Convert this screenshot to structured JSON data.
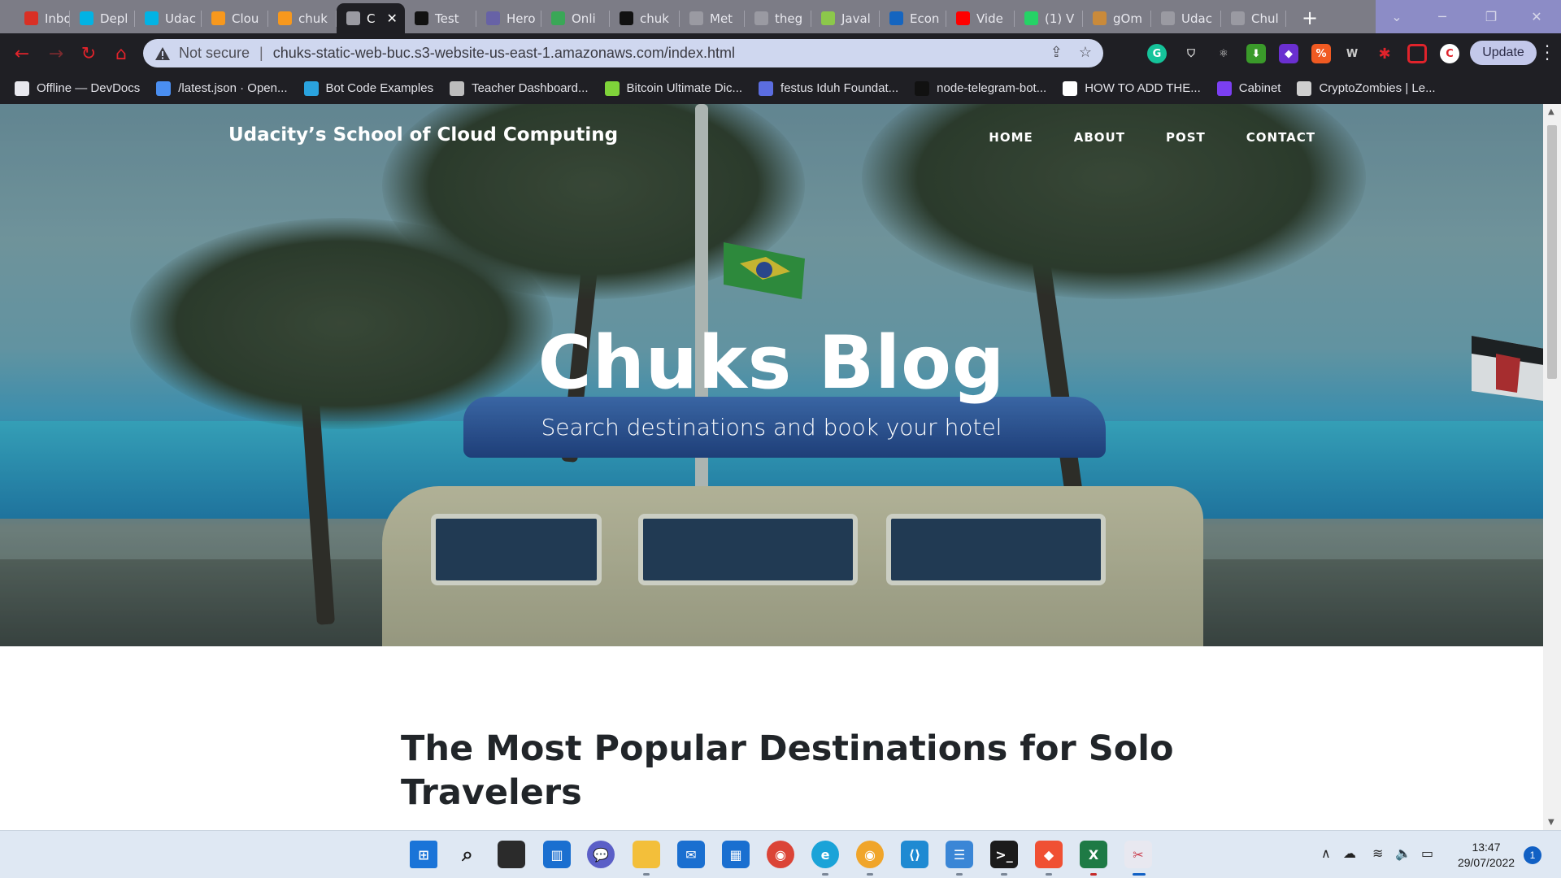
{
  "browser": {
    "tabs": [
      {
        "label": "Inbox",
        "icon": "gmail-icon",
        "color": "#d93025"
      },
      {
        "label": "Depl",
        "icon": "udacity-icon",
        "color": "#02b3e4"
      },
      {
        "label": "Udac",
        "icon": "udacity-icon",
        "color": "#02b3e4"
      },
      {
        "label": "Clou",
        "icon": "aws-icon",
        "color": "#f7981d"
      },
      {
        "label": "chuk",
        "icon": "aws-icon",
        "color": "#f7981d"
      },
      {
        "label": "C",
        "icon": "globe-icon",
        "color": "#9a9aa2",
        "active": true
      },
      {
        "label": "Test",
        "icon": "codementor-icon",
        "color": "#111111"
      },
      {
        "label": "Hero",
        "icon": "heroku-icon",
        "color": "#6762a6"
      },
      {
        "label": "Onli",
        "icon": "online-tool-icon",
        "color": "#3aa757"
      },
      {
        "label": "chuk",
        "icon": "github-icon",
        "color": "#111111"
      },
      {
        "label": "Met",
        "icon": "globe-icon",
        "color": "#9a9aa2"
      },
      {
        "label": "theg",
        "icon": "globe-icon",
        "color": "#9a9aa2"
      },
      {
        "label": "Javal",
        "icon": "javascript-icon",
        "color": "#8cc84b"
      },
      {
        "label": "Econ",
        "icon": "econ-icon",
        "color": "#1565c0"
      },
      {
        "label": "Vide",
        "icon": "youtube-icon",
        "color": "#ff0000"
      },
      {
        "label": "(1) V",
        "icon": "whatsapp-icon",
        "color": "#25d366"
      },
      {
        "label": "gOm",
        "icon": "avatar-icon",
        "color": "#c98a3a"
      },
      {
        "label": "Udac",
        "icon": "globe-icon",
        "color": "#9a9aa2"
      },
      {
        "label": "Chul",
        "icon": "globe-icon",
        "color": "#9a9aa2"
      }
    ],
    "address": {
      "security_label": "Not secure",
      "separator": "|",
      "url": "chuks-static-web-buc.s3-website-us-east-1.amazonaws.com/index.html"
    },
    "update_label": "Update",
    "bookmarks": [
      {
        "label": "Offline — DevDocs",
        "icon": "devdocs-icon",
        "color": "#e8e8ee"
      },
      {
        "label": "/latest.json · Open...",
        "icon": "book-icon",
        "color": "#4a8ef0"
      },
      {
        "label": "Bot Code Examples",
        "icon": "telegram-icon",
        "color": "#2aa3de"
      },
      {
        "label": "Teacher Dashboard...",
        "icon": "s-icon",
        "color": "#bdbdbd"
      },
      {
        "label": "Bitcoin Ultimate Dic...",
        "icon": "b-icon",
        "color": "#7fd33a"
      },
      {
        "label": "festus Iduh Foundat...",
        "icon": "teams-icon",
        "color": "#5b6de0"
      },
      {
        "label": "node-telegram-bot...",
        "icon": "github-icon",
        "color": "#111111"
      },
      {
        "label": "HOW TO ADD THE...",
        "icon": "k-icon",
        "color": "#ffffff"
      },
      {
        "label": "Cabinet",
        "icon": "cabinet-icon",
        "color": "#7b3ff2"
      },
      {
        "label": "CryptoZombies | Le...",
        "icon": "zombie-icon",
        "color": "#cfcfcf"
      }
    ]
  },
  "site": {
    "brand": "Udacity’s School of Cloud Computing",
    "nav": [
      "HOME",
      "ABOUT",
      "POST",
      "CONTACT"
    ],
    "hero_title": "Chuks Blog",
    "hero_subtitle": "Search destinations and book your hotel",
    "post_heading": "The Most Popular Destinations for Solo Travelers"
  },
  "taskbar": {
    "apps": [
      "windows-start-icon",
      "search-icon",
      "task-view-icon",
      "widgets-icon",
      "teams-chat-icon",
      "file-explorer-icon",
      "mail-icon",
      "store-icon",
      "chrome-icon",
      "edge-icon",
      "chrome-canary-icon",
      "vscode-icon",
      "notepad-icon",
      "terminal-icon",
      "git-icon",
      "excel-icon",
      "snipping-tool-icon"
    ],
    "time": "13:47",
    "date": "29/07/2022",
    "notification_count": "1"
  }
}
